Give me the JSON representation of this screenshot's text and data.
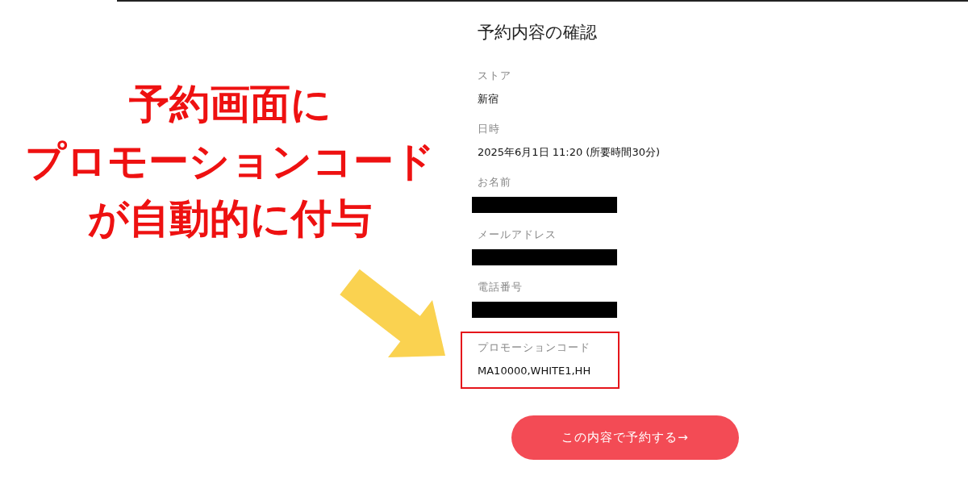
{
  "annotation": {
    "lines": [
      "予約画面に",
      "プロモーションコード",
      "が自動的に付与"
    ]
  },
  "form": {
    "title": "予約内容の確認",
    "fields": [
      {
        "label": "ストア",
        "kind": "text",
        "value": "新宿",
        "highlighted": false
      },
      {
        "label": "日時",
        "kind": "text",
        "value": "2025年6月1日 11:20 (所要時間30分)",
        "highlighted": false
      },
      {
        "label": "お名前",
        "kind": "redacted",
        "highlighted": false
      },
      {
        "label": "メールアドレス",
        "kind": "redacted",
        "highlighted": false
      },
      {
        "label": "電話番号",
        "kind": "redacted",
        "highlighted": false
      },
      {
        "label": "プロモーションコード",
        "kind": "text",
        "value": "MA10000,WHITE1,HH",
        "highlighted": true
      }
    ],
    "submit_button": "この内容で予約する→"
  }
}
